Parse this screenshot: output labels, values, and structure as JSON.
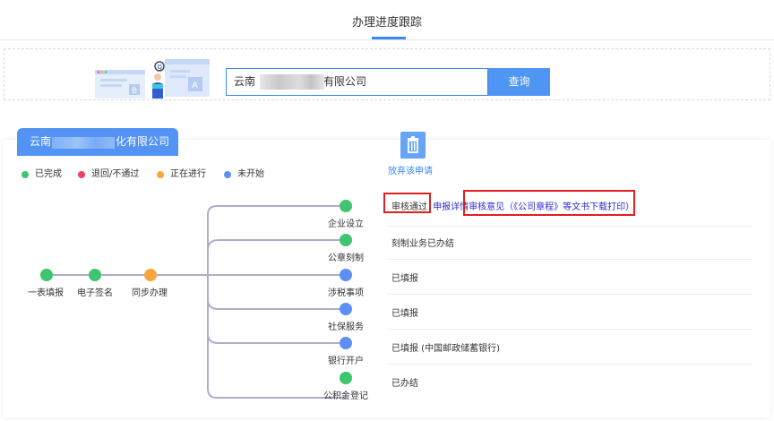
{
  "header": {
    "title": "办理进度跟踪"
  },
  "search": {
    "value": "云南█████████有限公司",
    "prefix": "云南",
    "suffix": "有限公司",
    "button_label": "查询"
  },
  "card": {
    "company_tab": {
      "prefix": "云南",
      "suffix": "化有限公司"
    },
    "legend": [
      {
        "label": "已完成",
        "color": "#3ec56f"
      },
      {
        "label": "退回/不通过",
        "color": "#f0415e"
      },
      {
        "label": "正在进行",
        "color": "#f7a53c"
      },
      {
        "label": "未开始",
        "color": "#5d8ff5"
      }
    ],
    "abandon_label": "放弃该申请",
    "main_steps": [
      {
        "label": "一表填报",
        "status": "done"
      },
      {
        "label": "电子签名",
        "status": "done"
      },
      {
        "label": "同步办理",
        "status": "in-progress"
      }
    ],
    "branches": [
      {
        "label": "企业设立",
        "status": "done",
        "status_text": "审核通过",
        "link_1": "申报详情",
        "link_2": "审核意见（《公司章程》等文书下载打印）"
      },
      {
        "label": "公章刻制",
        "status": "done",
        "status_text": "刻制业务已办结"
      },
      {
        "label": "涉税事项",
        "status": "not-started",
        "status_text": "已填报"
      },
      {
        "label": "社保服务",
        "status": "not-started",
        "status_text": "已填报"
      },
      {
        "label": "银行开户",
        "status": "not-started",
        "status_text": "已填报 (中国邮政储蓄银行)"
      },
      {
        "label": "公积金登记",
        "status": "done",
        "status_text": "已办结"
      }
    ]
  },
  "colors": {
    "done": "#3ec56f",
    "in_progress": "#f7a53c",
    "not_started": "#5d8ff5",
    "accent": "#3a88f5",
    "connector": "#b3aacb",
    "highlight_box": "#e02020"
  }
}
